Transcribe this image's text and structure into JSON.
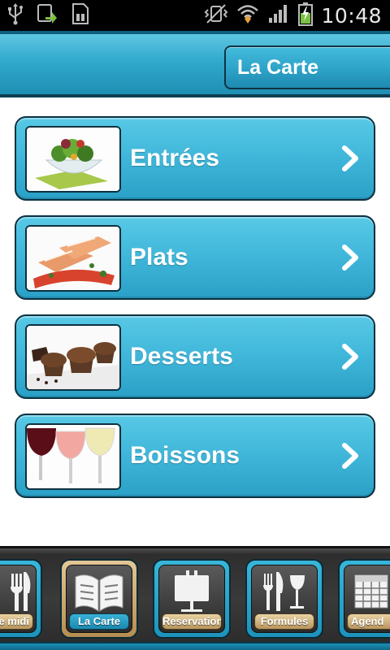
{
  "status_bar": {
    "time": "10:48",
    "icons": [
      "usb-icon",
      "sync-icon",
      "sd-card-icon",
      "vibrate-icon",
      "wifi-icon",
      "signal-icon",
      "battery-charging-icon"
    ]
  },
  "header": {
    "title": "La Carte"
  },
  "menu": {
    "items": [
      {
        "label": "Entrées",
        "image": "salad-image",
        "icon": "chevron-right-icon"
      },
      {
        "label": "Plats",
        "image": "salmon-dish-image",
        "icon": "chevron-right-icon"
      },
      {
        "label": "Desserts",
        "image": "muffins-image",
        "icon": "chevron-right-icon"
      },
      {
        "label": "Boissons",
        "image": "wine-glasses-image",
        "icon": "chevron-right-icon"
      }
    ]
  },
  "tab_bar": {
    "tabs": [
      {
        "label": "e midi",
        "icon": "cutlery-icon",
        "active": false
      },
      {
        "label": "La Carte",
        "icon": "open-menu-book-icon",
        "active": true
      },
      {
        "label": "Reservations",
        "icon": "reserved-sign-icon",
        "active": false
      },
      {
        "label": "Formules",
        "icon": "cutlery-glass-icon",
        "active": false
      },
      {
        "label": "Agend",
        "icon": "calendar-icon",
        "active": false
      }
    ]
  },
  "colors": {
    "accent_blue": "#3fb6d9",
    "dark_outline": "#0c3140",
    "active_tab_gold": "#c9a66b",
    "status_bar": "#000000"
  }
}
